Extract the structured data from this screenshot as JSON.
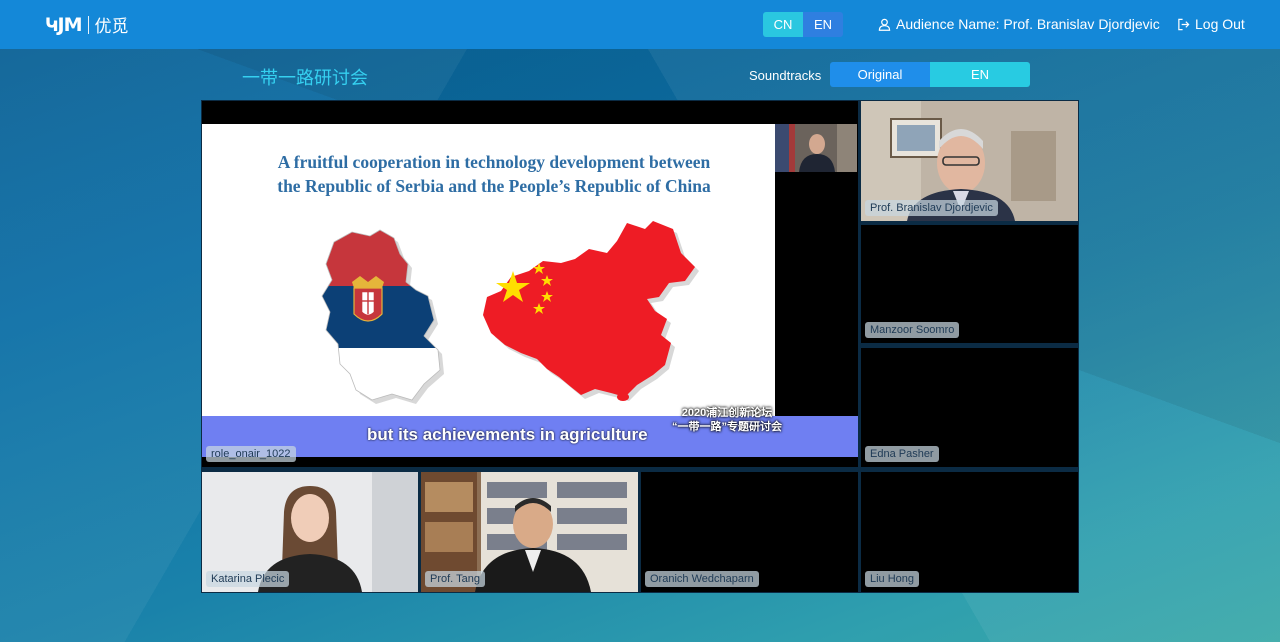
{
  "header": {
    "logo_mark": "ԿJM",
    "logo_text": "优觅",
    "lang": {
      "cn": "CN",
      "en": "EN",
      "active": "CN"
    },
    "audience_label": "Audience Name: Prof. Branislav Djordjevic",
    "logout_label": "Log Out"
  },
  "room": {
    "title": "一带一路研讨会",
    "soundtracks_label": "Soundtracks",
    "soundtracks": {
      "original": "Original",
      "en": "EN",
      "active": "Original"
    }
  },
  "main_stream": {
    "name": "role_onair_1022",
    "slide_title_line1": "A fruitful cooperation in technology development between",
    "slide_title_line2": "the Republic of Serbia and the People’s Republic of China",
    "caption": "but its achievements in agriculture",
    "forum_line1": "2020浦江创新论坛",
    "forum_line2": "“一带一路”专题研讨会"
  },
  "participants": [
    {
      "name": "Prof. Branislav Djordjevic"
    },
    {
      "name": "Manzoor Soomro"
    },
    {
      "name": "Edna Pasher"
    },
    {
      "name": "Katarina Plecic"
    },
    {
      "name": "Prof. Tang"
    },
    {
      "name": "Oranich Wedchaparn"
    },
    {
      "name": "Liu Hong"
    }
  ],
  "colors": {
    "topbar": "#1488d8",
    "accent_cyan": "#2ac7e0",
    "accent_blue": "#2f7fe0",
    "title_cyan": "#35d0f0",
    "serbia_red": "#c6363c",
    "serbia_blue": "#0c4076",
    "china_red": "#ee1c25",
    "china_star": "#ffde00"
  }
}
